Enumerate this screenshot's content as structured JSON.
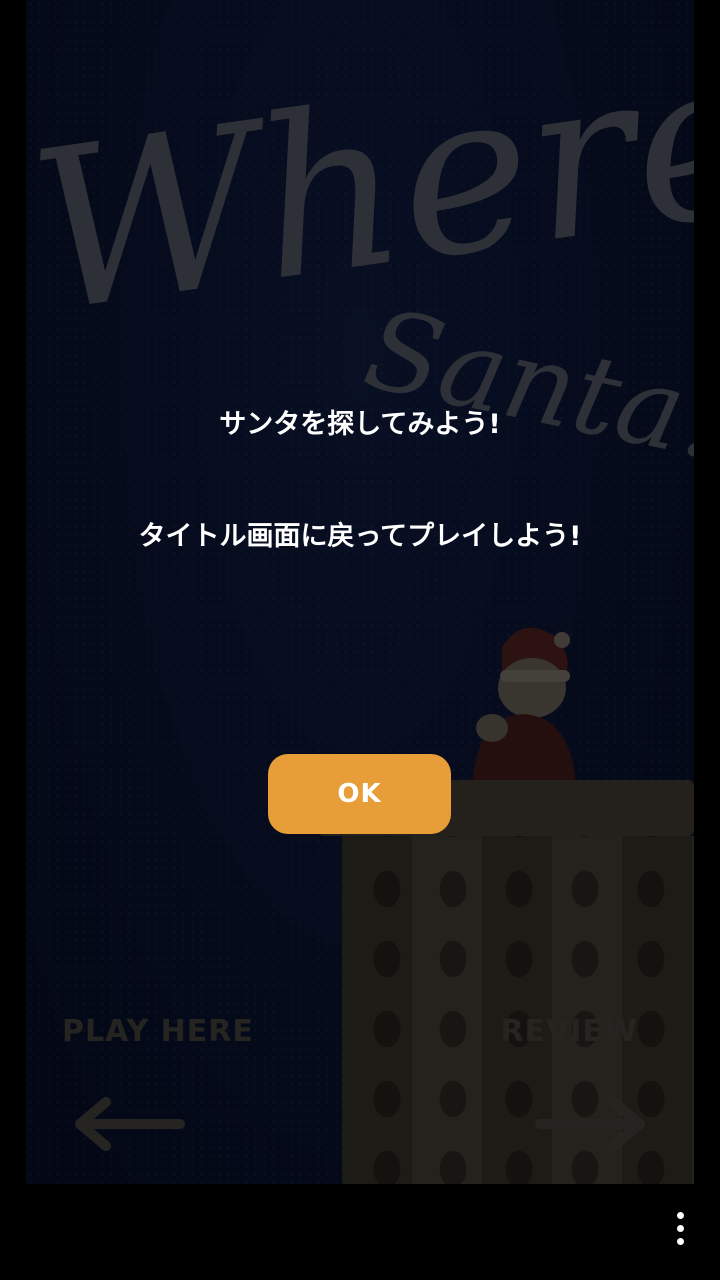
{
  "background": {
    "title_line1": "Where's",
    "title_line2": "Santa?",
    "left_label": "PLAY HERE",
    "right_label": "REVIEW"
  },
  "dialog": {
    "line1": "サンタを探してみよう!",
    "line2": "タイトル画面に戻ってプレイしよう!",
    "ok_label": "OK"
  },
  "colors": {
    "button": "#e89e38",
    "background": "#0a1330"
  }
}
